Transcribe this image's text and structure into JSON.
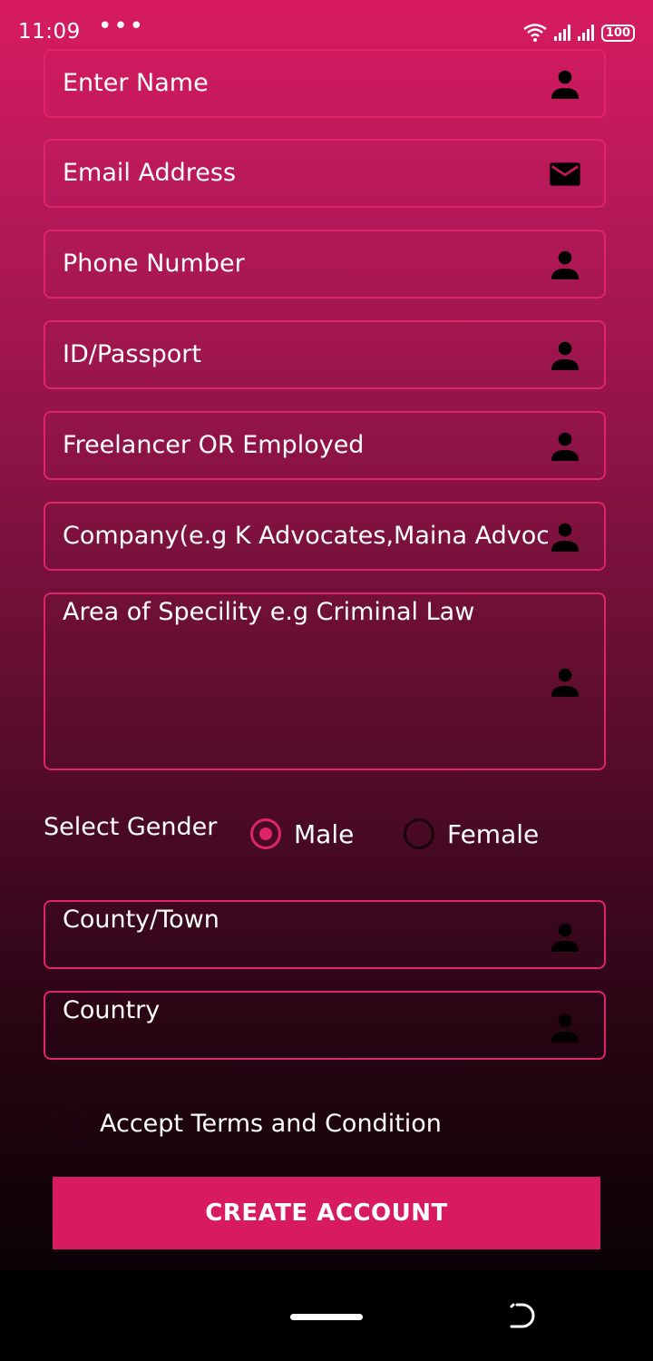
{
  "status_bar": {
    "time": "11:09",
    "dots": "•••",
    "battery": "100"
  },
  "form": {
    "name_placeholder": "Enter Name",
    "email_placeholder": "Email Address",
    "phone_placeholder": "Phone Number",
    "id_placeholder": "ID/Passport",
    "employment_placeholder": "Freelancer OR Employed",
    "company_placeholder": "Company(e.g K Advocates,Maina Advocates)",
    "speciality_placeholder": "Area of Specility e.g Criminal Law",
    "gender": {
      "label": "Select Gender",
      "options": [
        "Male",
        "Female"
      ],
      "selected": "Male"
    },
    "county_placeholder": "County/Town",
    "country_placeholder": "Country",
    "terms_label": "Accept Terms and Condition",
    "terms_checked": false,
    "submit_label": "CREATE ACCOUNT"
  },
  "icons": {
    "person": "person-icon",
    "mail": "mail-icon"
  },
  "colors": {
    "accent": "#d81b60",
    "border": "#e0246a"
  }
}
